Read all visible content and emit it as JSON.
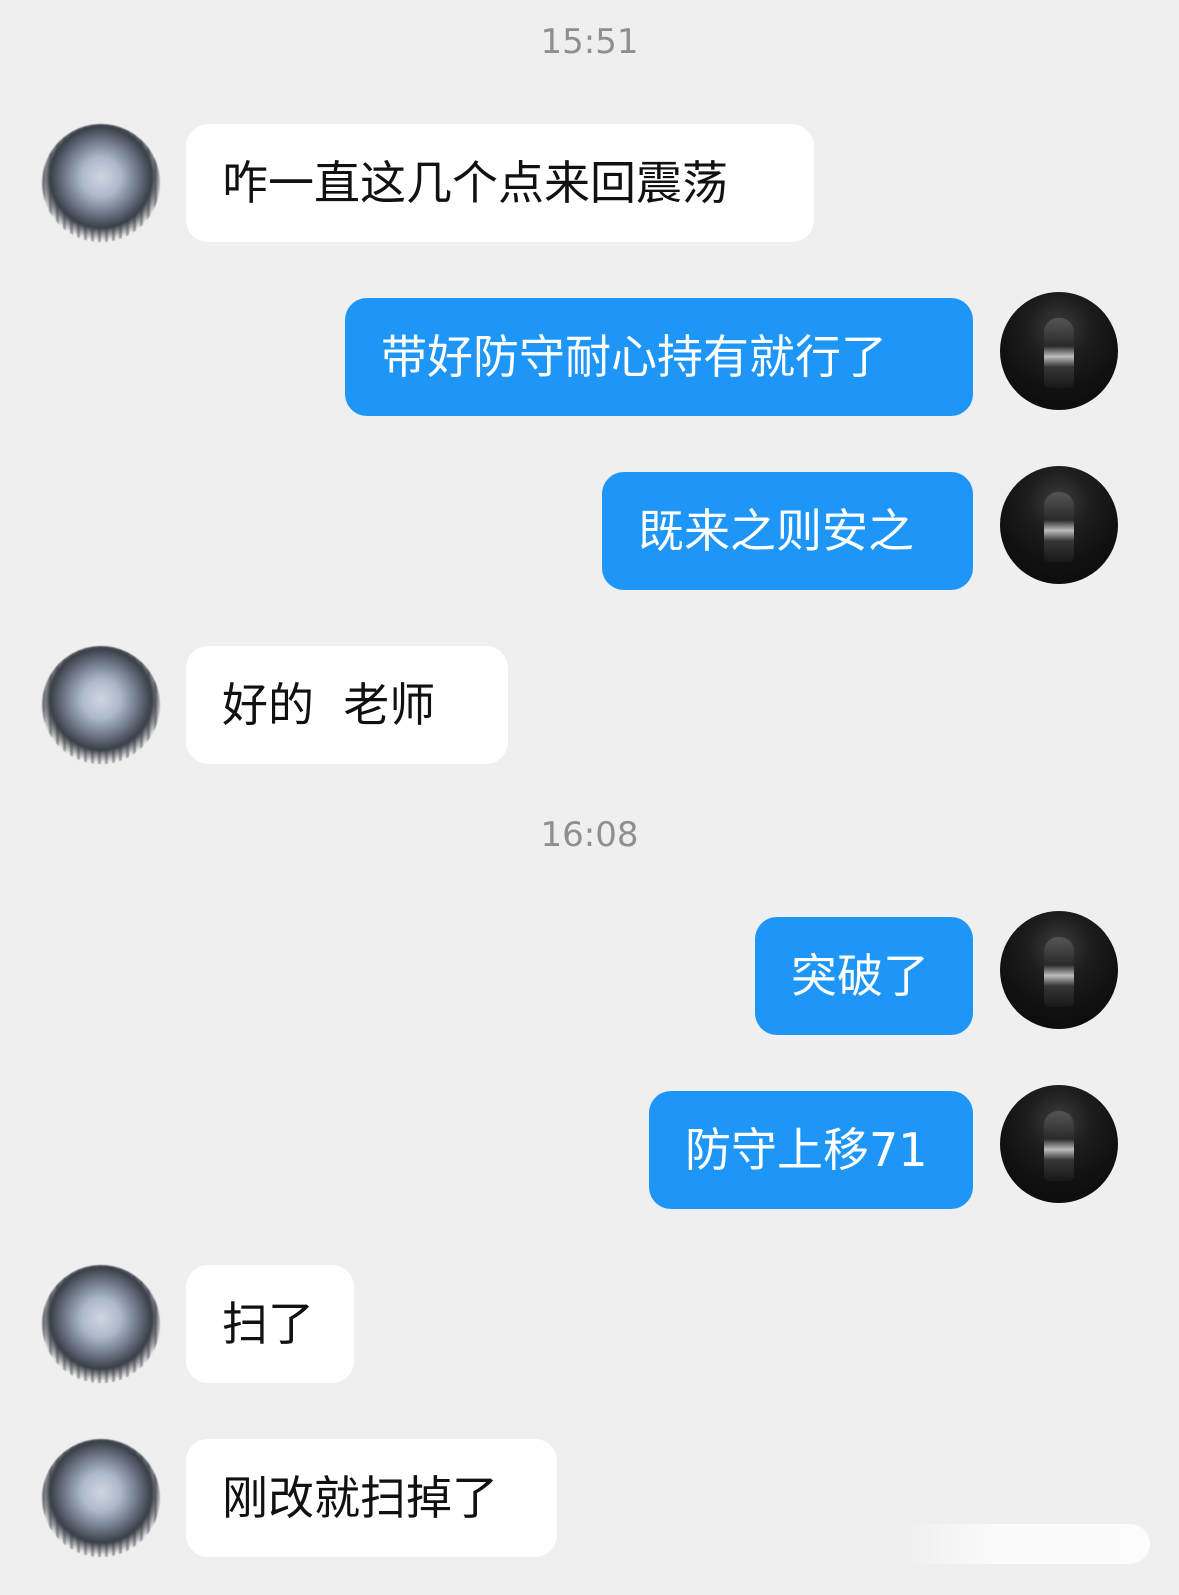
{
  "timestamps": {
    "first": "15:51",
    "second": "16:08"
  },
  "messages": [
    {
      "side": "in",
      "text": "咋一直这几个点来回震荡"
    },
    {
      "side": "out",
      "text": "带好防守耐心持有就行了"
    },
    {
      "side": "out",
      "text": "既来之则安之"
    },
    {
      "side": "in",
      "text": "好的  老师"
    },
    {
      "side": "out",
      "text": "突破了"
    },
    {
      "side": "out",
      "text": "防守上移71"
    },
    {
      "side": "in",
      "text": "扫了"
    },
    {
      "side": "in",
      "text": "刚改就扫掉了"
    }
  ],
  "colors": {
    "background": "#efefef",
    "incoming_bubble": "#ffffff",
    "outgoing_bubble": "#1e96f7",
    "timestamp_text": "#8e8e93"
  },
  "icons": {
    "left_avatar": "contact-avatar-icon",
    "right_avatar": "user-avatar-icon"
  }
}
